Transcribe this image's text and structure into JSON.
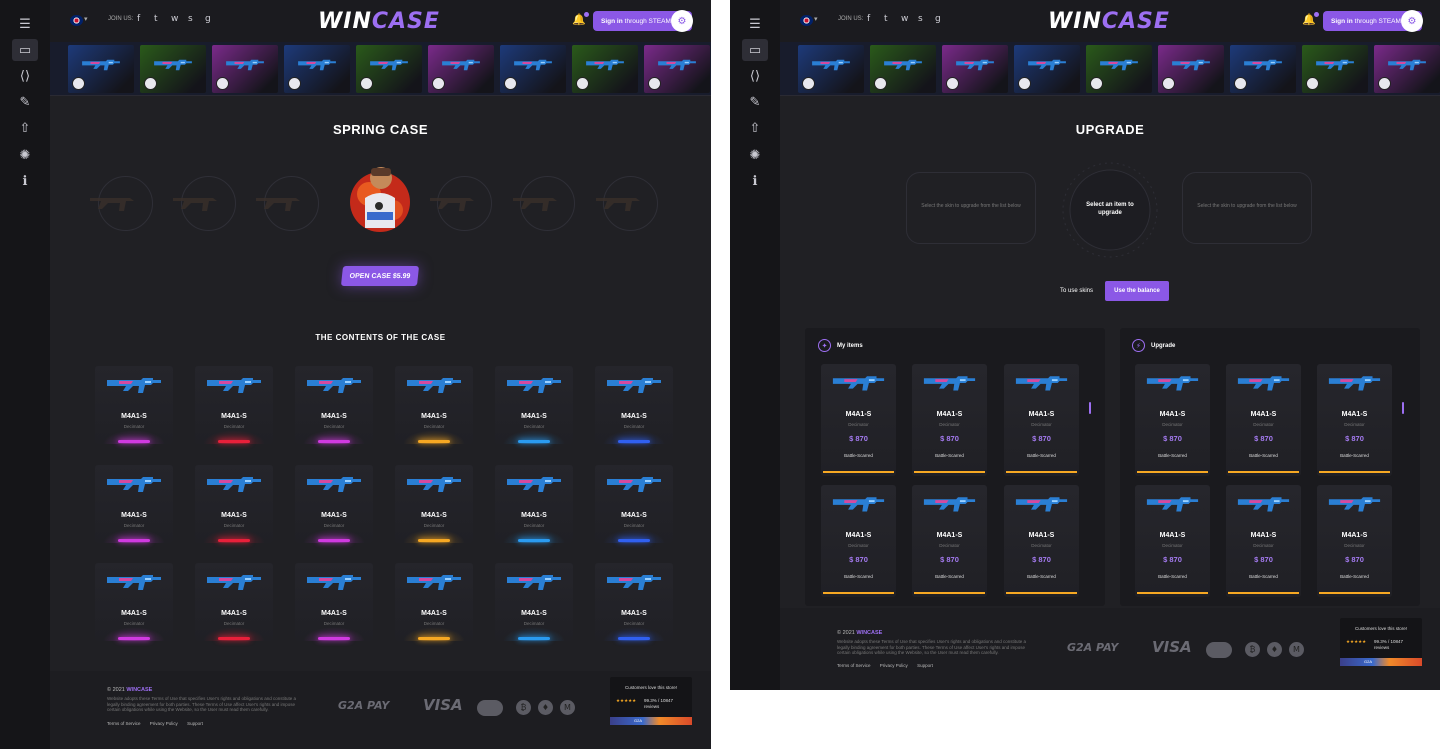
{
  "brand": {
    "logo_a": "WIN",
    "logo_b": "CASE",
    "accent": "#8b58e6"
  },
  "header": {
    "join_us": "JOIN US:",
    "sign_in_bold": "Sign in",
    "sign_in_rest": "through STEAM"
  },
  "sidebar": {
    "items": [
      {
        "icon": "hamburger-icon",
        "glyph": "☰"
      },
      {
        "icon": "case-icon",
        "glyph": "▭"
      },
      {
        "icon": "code-icon",
        "glyph": "⟨⟩"
      },
      {
        "icon": "edit-icon",
        "glyph": "✎"
      },
      {
        "icon": "upgrade-arrow-icon",
        "glyph": "⇧"
      },
      {
        "icon": "sun-icon",
        "glyph": "✺"
      },
      {
        "icon": "info-icon",
        "glyph": "ℹ"
      }
    ]
  },
  "social": [
    "f",
    "t",
    "w",
    "s",
    "g"
  ],
  "case_page": {
    "title": "SPRING CASE",
    "open_button": "OPEN CASE $5.99",
    "contents_title": "THE CONTENTS OF THE CASE",
    "item_name": "M4A1-S",
    "item_sub": "Decimator",
    "rarity_colors": [
      "#d03ae0",
      "#e8203a",
      "#d03ae0",
      "#f6a823",
      "#2a9bf0",
      "#3060f0"
    ]
  },
  "upgrade_page": {
    "title": "UPGRADE",
    "left_hint": "Select the skin to upgrade from the list below",
    "center_hint": "Select an item to upgrade",
    "right_hint": "Select the skin to upgrade from the list below",
    "tab_skins": "To use skins",
    "tab_balance": "Use the balance",
    "my_items": "My items",
    "upgrade": "Upgrade",
    "item_name": "M4A1-S",
    "item_sub": "Decimator",
    "item_price": "$ 870",
    "item_wear": "Battle-Scarred"
  },
  "footer": {
    "copyright": "© 2021",
    "brand": "WINCASE",
    "text": "Website adopts these Terms of Use that specifies User's rights and obligations and constitute a legally binding agreement for both parties. These Terms of Use affect User's rights and impose certain obligations while using the Website, so the User must read them carefully.",
    "links": [
      "Terms of Service",
      "Privacy Policy",
      "Support"
    ],
    "pay_g2a": "G2A PAY",
    "pay_visa": "VISA",
    "coins": [
      "₿",
      "♦",
      "M"
    ],
    "review_title": "Customers love this store!",
    "review_stars": "★★★★★",
    "review_score": "99.3% / 10847",
    "review_count": "reviews",
    "review_badge": "G2A"
  }
}
